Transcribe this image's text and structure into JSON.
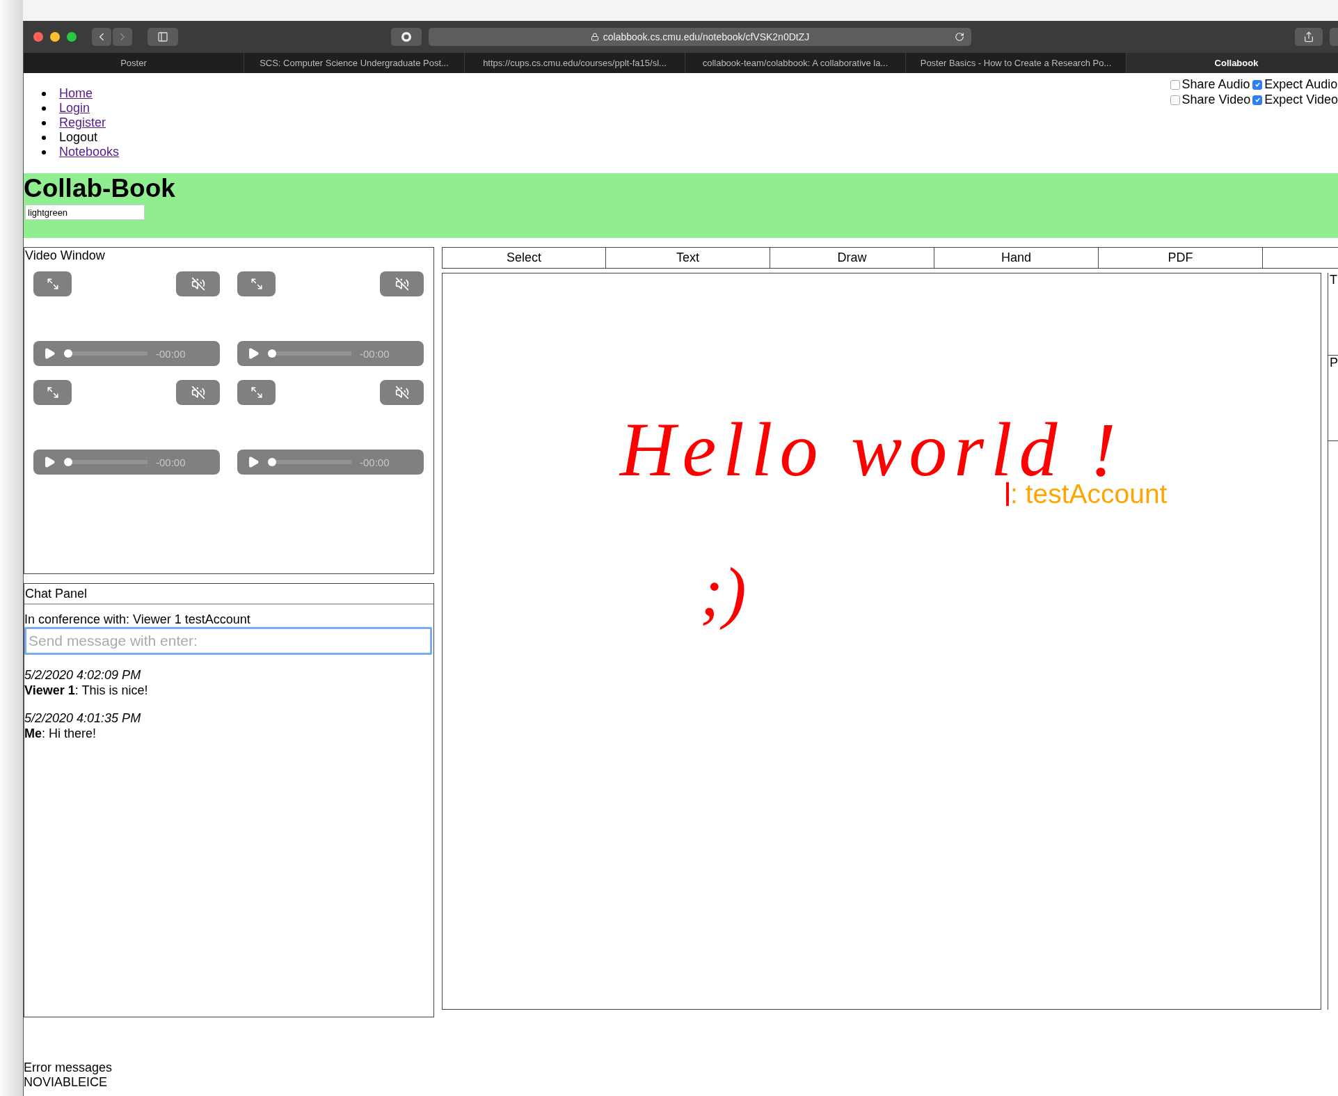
{
  "browser": {
    "url": "colabbook.cs.cmu.edu/notebook/cfVSK2n0DtZJ",
    "tabs": [
      {
        "label": "Poster",
        "selected": false
      },
      {
        "label": "SCS: Computer Science Undergraduate Post...",
        "selected": false
      },
      {
        "label": "https://cups.cs.cmu.edu/courses/pplt-fa15/sl...",
        "selected": false
      },
      {
        "label": "collabook-team/colabbook: A collaborative la...",
        "selected": false
      },
      {
        "label": "Poster Basics - How to Create a Research Po...",
        "selected": false
      },
      {
        "label": "Collabook",
        "selected": true
      }
    ]
  },
  "nav": [
    {
      "label": "Home",
      "link": true
    },
    {
      "label": "Login",
      "link": true
    },
    {
      "label": "Register",
      "link": true
    },
    {
      "label": "Logout",
      "link": false
    },
    {
      "label": "Notebooks",
      "link": true
    }
  ],
  "media_options": [
    {
      "label": "Share Audio",
      "checked": false
    },
    {
      "label": "Expect Audio",
      "checked": true
    },
    {
      "label": "Share Video",
      "checked": false
    },
    {
      "label": "Expect Video",
      "checked": true
    }
  ],
  "header": {
    "title": "Collab-Book",
    "color_field": {
      "value": "lightgreen"
    }
  },
  "video_window": {
    "title": "Video Window",
    "tiles": [
      {
        "time": "-00:00",
        "level": 0
      },
      {
        "time": "-00:00",
        "level": 0
      },
      {
        "time": "-00:00",
        "level": 0
      },
      {
        "time": "-00:00",
        "level": 0
      }
    ]
  },
  "chat_panel": {
    "title": "Chat Panel",
    "conference": "In conference with: Viewer 1 testAccount",
    "input": {
      "placeholder": "Send message with enter:"
    },
    "messages": [
      {
        "timestamp": "5/2/2020 4:02:09 PM",
        "text": "**Viewer 1**: This is nice!"
      },
      {
        "timestamp": "5/2/2020 4:01:35 PM",
        "text": "**Me**: Hi there!"
      }
    ]
  },
  "tools": [
    {
      "label": "Select"
    },
    {
      "label": "Text"
    },
    {
      "label": "Draw"
    },
    {
      "label": "Hand"
    },
    {
      "label": "PDF"
    }
  ],
  "canvas": {
    "handwriting": [
      {
        "text": "Hello world !",
        "kind": "main"
      },
      {
        "text": ";)",
        "kind": "small"
      }
    ],
    "cursor": {
      "label": ": testAccount"
    }
  },
  "side_panel": [
    {
      "label": "T"
    },
    {
      "label": "P"
    }
  ],
  "errors": {
    "title": "Error messages",
    "items": [
      "NOVIABLEICE"
    ]
  }
}
